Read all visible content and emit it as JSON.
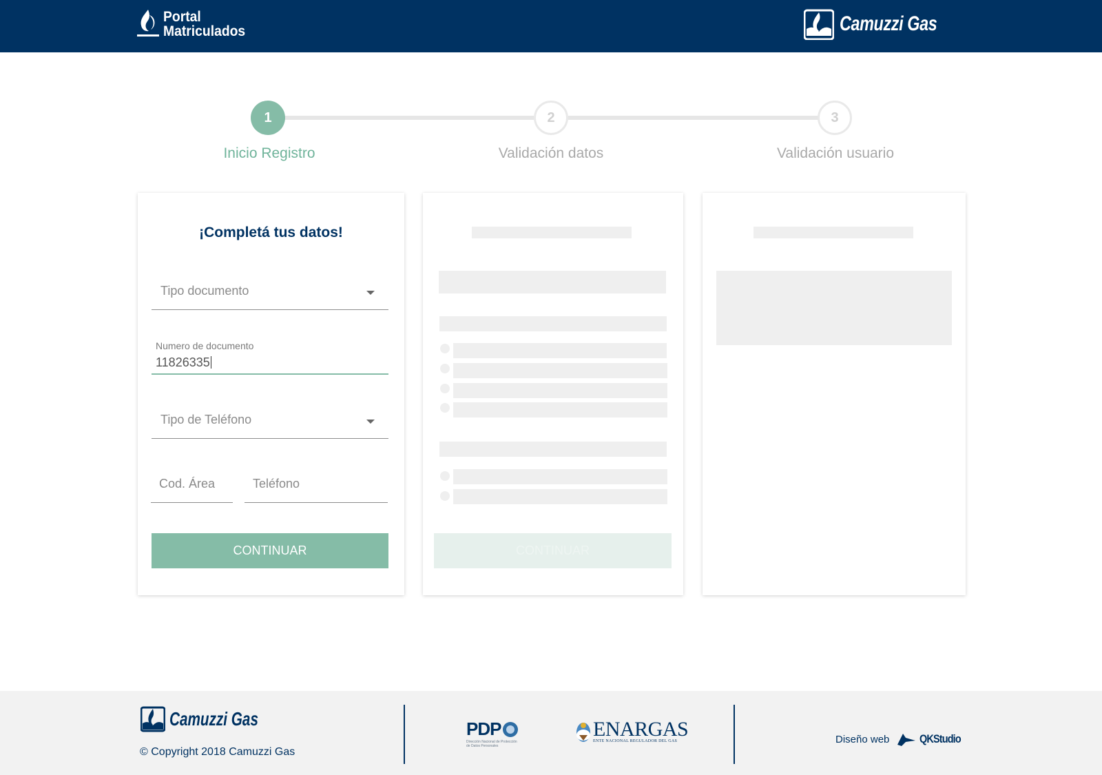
{
  "header": {
    "portal_line1": "Portal",
    "portal_line2": "Matriculados",
    "brand": "Camuzzi Gas"
  },
  "stepper": {
    "steps": [
      {
        "number": "1",
        "label": "Inicio Registro",
        "state": "active"
      },
      {
        "number": "2",
        "label": "Validación datos",
        "state": "inactive"
      },
      {
        "number": "3",
        "label": "Validación usuario",
        "state": "inactive"
      }
    ]
  },
  "form": {
    "title": "¡Completá tus datos!",
    "tipo_documento_placeholder": "Tipo documento",
    "numero_documento_label": "Numero de documento",
    "numero_documento_value": "11826335",
    "tipo_telefono_placeholder": "Tipo de Teléfono",
    "cod_area_placeholder": "Cod. Área",
    "telefono_placeholder": "Teléfono",
    "continue_label": "CONTINUAR"
  },
  "card2": {
    "continue_label": "CONTINUAR"
  },
  "footer": {
    "brand": "Camuzzi Gas",
    "copyright": "© Copyright 2018 Camuzzi Gas",
    "pdp_label": "PDP",
    "pdp_sub": "Dirección Nacional de Protección de Datos Personales",
    "enargas_label": "ENARGAS",
    "enargas_sub": "ENTE NACIONAL REGULADOR DEL GAS",
    "designer_label": "Diseño web",
    "designer_brand": "QKStudio"
  },
  "colors": {
    "header_bg": "#003262",
    "accent": "#85bca7",
    "footer_bg": "#f2f2f2"
  }
}
